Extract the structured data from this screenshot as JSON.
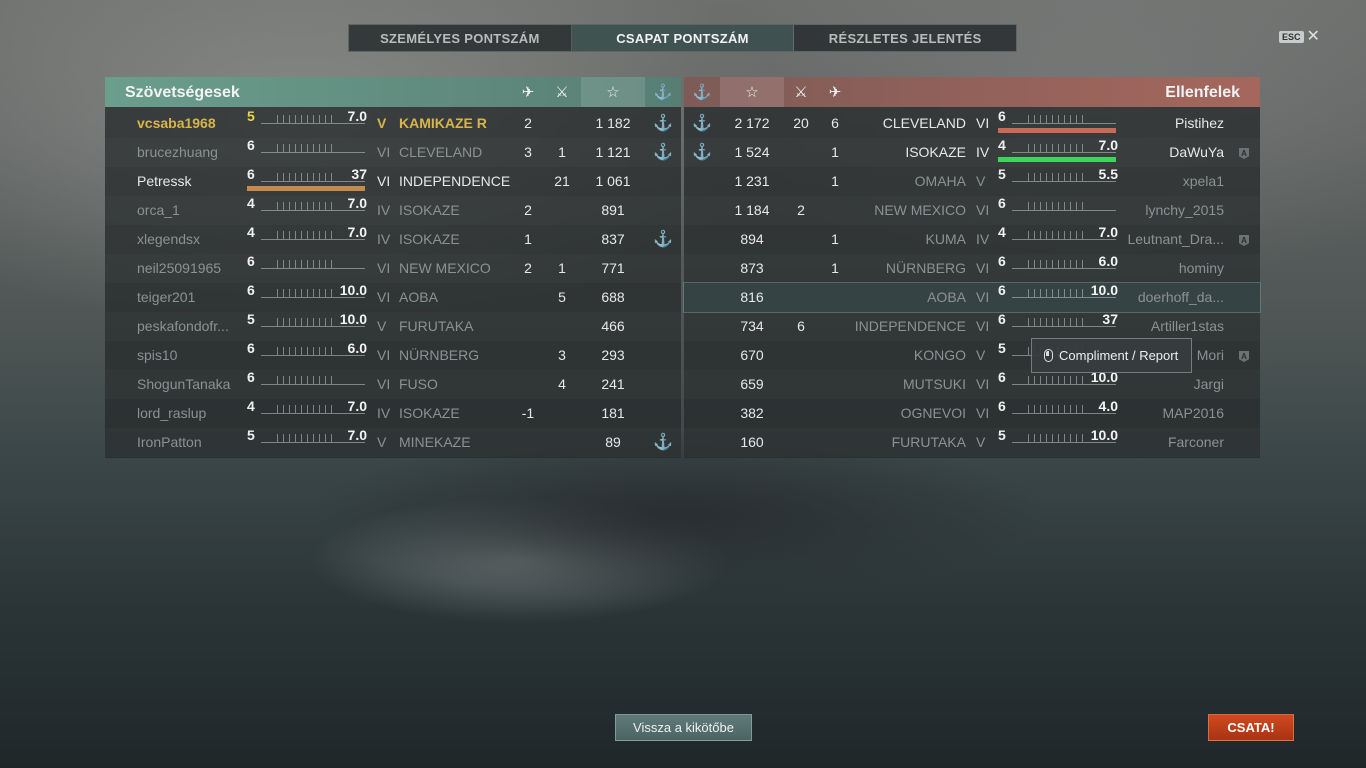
{
  "tabs": [
    {
      "label": "SZEMÉLYES PONTSZÁM",
      "active": false
    },
    {
      "label": "CSAPAT PONTSZÁM",
      "active": true
    },
    {
      "label": "RÉSZLETES JELENTÉS",
      "active": false
    }
  ],
  "esc": {
    "key": "ESC",
    "close": "✕"
  },
  "allies": {
    "title": "Szövetségesek",
    "header_icons": [
      "plane-icon",
      "crossed-swords-icon",
      "star-icon",
      "anchor-icon"
    ],
    "header_glyphs": {
      "plane": "✈",
      "swords": "⚔",
      "star": "☆",
      "anchor": "⚓"
    },
    "rows": [
      {
        "player": "vcsaba1968",
        "tier_num": "5",
        "hp": "7.0",
        "tier": "V",
        "ship": "KAMIKAZE R",
        "planes": "2",
        "kills": "",
        "score": "1 182",
        "anchor": "⚓",
        "state": "self"
      },
      {
        "player": "brucezhuang",
        "tier_num": "6",
        "hp": "",
        "tier": "VI",
        "ship": "CLEVELAND",
        "planes": "3",
        "kills": "1",
        "score": "1 121",
        "anchor": "⚓",
        "state": "dead"
      },
      {
        "player": "Petressk",
        "tier_num": "6",
        "hp": "37",
        "tier": "VI",
        "ship": "INDEPENDENCE",
        "planes": "",
        "kills": "21",
        "score": "1 061",
        "anchor": "",
        "state": "alive",
        "hp_color": "#c28a4c"
      },
      {
        "player": "orca_1",
        "tier_num": "4",
        "hp": "7.0",
        "tier": "IV",
        "ship": "ISOKAZE",
        "planes": "2",
        "kills": "",
        "score": "891",
        "anchor": "",
        "state": "dead"
      },
      {
        "player": "xlegendsx",
        "tier_num": "4",
        "hp": "7.0",
        "tier": "IV",
        "ship": "ISOKAZE",
        "planes": "1",
        "kills": "",
        "score": "837",
        "anchor": "⚓",
        "state": "dead"
      },
      {
        "player": "neil25091965",
        "tier_num": "6",
        "hp": "",
        "tier": "VI",
        "ship": "NEW MEXICO",
        "planes": "2",
        "kills": "1",
        "score": "771",
        "anchor": "",
        "state": "dead"
      },
      {
        "player": "teiger201",
        "tier_num": "6",
        "hp": "10.0",
        "tier": "VI",
        "ship": "AOBA",
        "planes": "",
        "kills": "5",
        "score": "688",
        "anchor": "",
        "state": "dead"
      },
      {
        "player": "peskafondofr...",
        "tier_num": "5",
        "hp": "10.0",
        "tier": "V",
        "ship": "FURUTAKA",
        "planes": "",
        "kills": "",
        "score": "466",
        "anchor": "",
        "state": "dead"
      },
      {
        "player": "spis10",
        "tier_num": "6",
        "hp": "6.0",
        "tier": "VI",
        "ship": "NÜRNBERG",
        "planes": "",
        "kills": "3",
        "score": "293",
        "anchor": "",
        "state": "dead"
      },
      {
        "player": "ShogunTanaka",
        "tier_num": "6",
        "hp": "",
        "tier": "VI",
        "ship": "FUSO",
        "planes": "",
        "kills": "4",
        "score": "241",
        "anchor": "",
        "state": "dead"
      },
      {
        "player": "lord_raslup",
        "tier_num": "4",
        "hp": "7.0",
        "tier": "IV",
        "ship": "ISOKAZE",
        "planes": "-1",
        "kills": "",
        "score": "181",
        "anchor": "",
        "state": "dead"
      },
      {
        "player": "IronPatton",
        "tier_num": "5",
        "hp": "7.0",
        "tier": "V",
        "ship": "MINEKAZE",
        "planes": "",
        "kills": "",
        "score": "89",
        "anchor": "⚓",
        "state": "dead"
      }
    ]
  },
  "enemies": {
    "title": "Ellenfelek",
    "header_icons": [
      "anchor-icon",
      "star-icon",
      "crossed-swords-icon",
      "plane-icon"
    ],
    "rows": [
      {
        "anchor": "⚓",
        "score": "2 172",
        "kills": "20",
        "planes": "6",
        "ship": "CLEVELAND",
        "tier": "VI",
        "tier_num": "6",
        "hp": "",
        "player": "Pistihez",
        "state": "alive",
        "hp_color": "#c86a55",
        "ai": false
      },
      {
        "anchor": "⚓",
        "score": "1 524",
        "kills": "",
        "planes": "1",
        "ship": "ISOKAZE",
        "tier": "IV",
        "tier_num": "4",
        "hp": "7.0",
        "player": "DaWuYa",
        "state": "alive",
        "hp_color": "#3bd65a",
        "ai": true
      },
      {
        "anchor": "",
        "score": "1 231",
        "kills": "",
        "planes": "1",
        "ship": "OMAHA",
        "tier": "V",
        "tier_num": "5",
        "hp": "5.5",
        "player": "xpela1",
        "state": "dead",
        "ai": false
      },
      {
        "anchor": "",
        "score": "1 184",
        "kills": "2",
        "planes": "",
        "ship": "NEW MEXICO",
        "tier": "VI",
        "tier_num": "6",
        "hp": "",
        "player": "lynchy_2015",
        "state": "dead",
        "ai": false
      },
      {
        "anchor": "",
        "score": "894",
        "kills": "",
        "planes": "1",
        "ship": "KUMA",
        "tier": "IV",
        "tier_num": "4",
        "hp": "7.0",
        "player": "Leutnant_Dra...",
        "state": "dead",
        "ai": true
      },
      {
        "anchor": "",
        "score": "873",
        "kills": "",
        "planes": "1",
        "ship": "NÜRNBERG",
        "tier": "VI",
        "tier_num": "6",
        "hp": "6.0",
        "player": "hominy",
        "state": "dead",
        "ai": false
      },
      {
        "anchor": "",
        "score": "816",
        "kills": "",
        "planes": "",
        "ship": "AOBA",
        "tier": "VI",
        "tier_num": "6",
        "hp": "10.0",
        "player": "doerhoff_da...",
        "state": "dead",
        "ai": false,
        "highlight": true
      },
      {
        "anchor": "",
        "score": "734",
        "kills": "6",
        "planes": "",
        "ship": "INDEPENDENCE",
        "tier": "VI",
        "tier_num": "6",
        "hp": "37",
        "player": "Artiller1stas",
        "state": "dead",
        "ai": false
      },
      {
        "anchor": "",
        "score": "670",
        "kills": "",
        "planes": "",
        "ship": "KONGO",
        "tier": "V",
        "tier_num": "5",
        "hp": "",
        "player": "Mori",
        "state": "dead",
        "ai": true
      },
      {
        "anchor": "",
        "score": "659",
        "kills": "",
        "planes": "",
        "ship": "MUTSUKI",
        "tier": "VI",
        "tier_num": "6",
        "hp": "10.0",
        "player": "Jargi",
        "state": "dead",
        "ai": false
      },
      {
        "anchor": "",
        "score": "382",
        "kills": "",
        "planes": "",
        "ship": "OGNEVOI",
        "tier": "VI",
        "tier_num": "6",
        "hp": "4.0",
        "player": "MAP2016",
        "state": "dead",
        "ai": false
      },
      {
        "anchor": "",
        "score": "160",
        "kills": "",
        "planes": "",
        "ship": "FURUTAKA",
        "tier": "V",
        "tier_num": "5",
        "hp": "10.0",
        "player": "Farconer",
        "state": "dead",
        "ai": false
      }
    ]
  },
  "tooltip": {
    "label": "Compliment / Report"
  },
  "ai_badge": "A",
  "buttons": {
    "back": "Vissza a kikötőbe",
    "battle": "CSATA!"
  },
  "colors": {
    "self": "#d8b44c",
    "dead": "#8c9193",
    "alive": "#e8e8e8",
    "anchor": "#d8b02c"
  }
}
